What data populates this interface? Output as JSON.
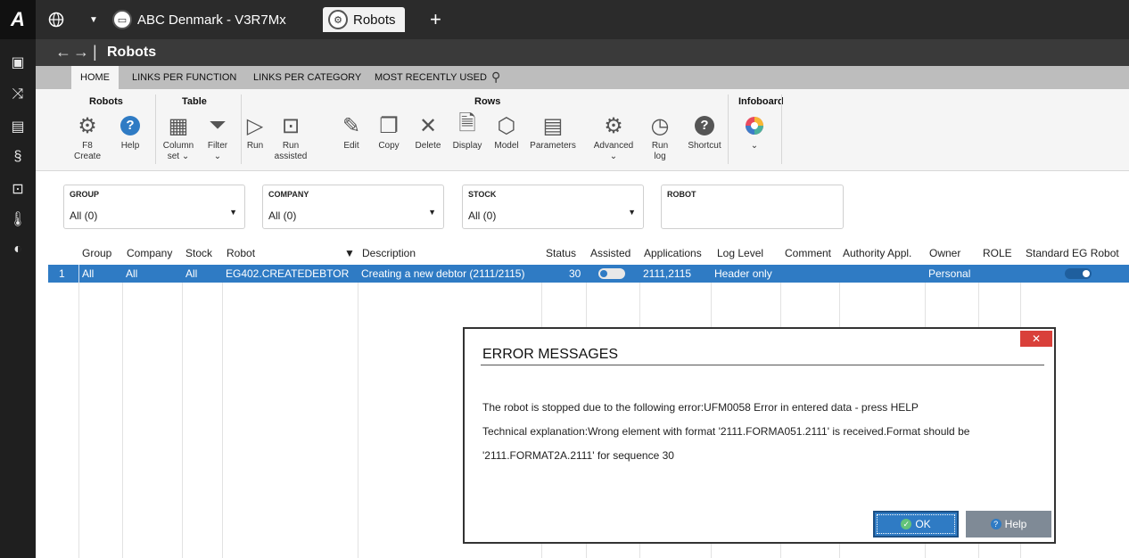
{
  "topbar": {
    "globe_icon": "globe-icon",
    "company_tab": "ABC Denmark - V3R7Mx",
    "robots_tab": "Robots",
    "add_tab": "+"
  },
  "nav": {
    "back": "←",
    "forward": "→",
    "separator": "|",
    "title": "Robots"
  },
  "ribbon_tabs": [
    "HOME",
    "LINKS PER FUNCTION",
    "LINKS PER CATEGORY",
    "MOST RECENTLY USED"
  ],
  "ribbon": {
    "groups": {
      "robots": "Robots",
      "table": "Table",
      "rows": "Rows",
      "infoboard": "Infoboard"
    },
    "buttons": {
      "f8_create": [
        "F8",
        "Create"
      ],
      "help": "Help",
      "column_set": [
        "Column",
        "set ⌄"
      ],
      "filter": [
        "Filter",
        "⌄"
      ],
      "run": "Run",
      "run_assisted": [
        "Run",
        "assisted"
      ],
      "edit": "Edit",
      "copy": "Copy",
      "delete": "Delete",
      "display": "Display",
      "model": "Model",
      "parameters": "Parameters",
      "advanced": [
        "Advanced",
        "⌄"
      ],
      "run_log": [
        "Run",
        "log"
      ],
      "shortcut": "Shortcut",
      "infoboard_expand": "⌄"
    }
  },
  "filters": {
    "group": {
      "label": "GROUP",
      "value": "All (0)"
    },
    "company": {
      "label": "COMPANY",
      "value": "All (0)"
    },
    "stock": {
      "label": "STOCK",
      "value": "All (0)"
    },
    "robot": {
      "label": "ROBOT",
      "value": ""
    }
  },
  "grid": {
    "headers": {
      "group": "Group",
      "company": "Company",
      "stock": "Stock",
      "robot": "Robot",
      "description": "Description",
      "status": "Status",
      "assisted": "Assisted",
      "applications": "Applications",
      "log_level": "Log Level",
      "comment": "Comment",
      "authority": "Authority Appl.",
      "owner": "Owner",
      "role": "ROLE",
      "standard": "Standard EG Robot"
    },
    "row": {
      "num": "1",
      "group": "All",
      "company": "All",
      "stock": "All",
      "robot": "EG402.CREATEDEBTOR",
      "description": "Creating a new debtor (2111/2115)",
      "status": "30",
      "assisted": false,
      "applications": "2111,2115",
      "log_level": "Header only",
      "comment": "",
      "authority": "",
      "owner": "Personal",
      "role": "",
      "standard": true
    }
  },
  "dialog": {
    "close": "✕",
    "title": "ERROR MESSAGES",
    "line1": "The robot is stopped due to the following error:UFM0058  Error in entered data - press HELP",
    "line2": "Technical explanation:Wrong element with format '2111.FORMA051.2111' is received.Format should be",
    "line3": "'2111.FORMAT2A.2111' for sequence 30",
    "ok": "OK",
    "help": "Help"
  },
  "colors": {
    "accent": "#2f7bc4",
    "close_red": "#d9403a",
    "dark_bar": "#2b2b2b"
  }
}
